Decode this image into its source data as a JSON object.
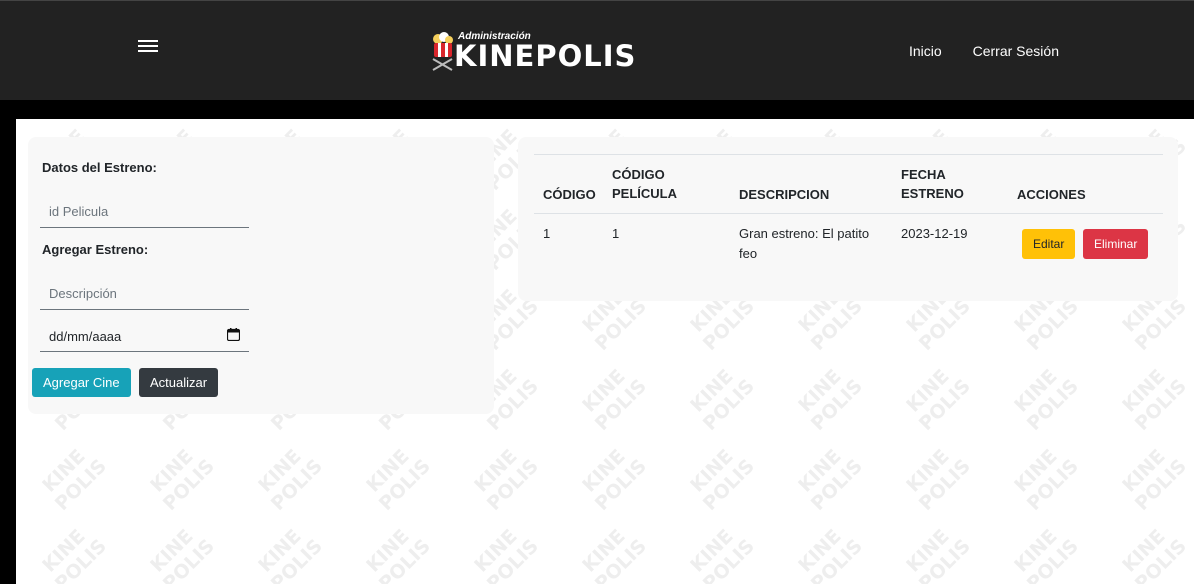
{
  "navbar": {
    "logo_sub": "Administración",
    "logo_main": "KINEPOLIS",
    "links": [
      {
        "label": "Inicio"
      },
      {
        "label": "Cerrar Sesión"
      }
    ]
  },
  "form": {
    "section1_label": "Datos del Estreno:",
    "id_pelicula_placeholder": "id Pelicula",
    "section2_label": "Agregar Estreno:",
    "descripcion_placeholder": "Descripción",
    "date_placeholder": "dd/mm/aaaa",
    "add_button": "Agregar Cine",
    "update_button": "Actualizar"
  },
  "table": {
    "headers": {
      "codigo": "CÓDIGO",
      "codigo_pelicula_line1": "CÓDIGO",
      "codigo_pelicula_line2": "PELÍCULA",
      "descripcion": "DESCRIPCION",
      "fecha_line1": "FECHA",
      "fecha_line2": "ESTRENO",
      "acciones": "ACCIONES"
    },
    "rows": [
      {
        "codigo": "1",
        "codigo_pelicula": "1",
        "descripcion_line1": "Gran estreno: El patito",
        "descripcion_line2": "feo",
        "fecha": "2023-12-19",
        "edit_label": "Editar",
        "delete_label": "Eliminar"
      }
    ]
  },
  "watermark_text": [
    "KINE",
    "POLIS"
  ],
  "colors": {
    "navbar": "#222222",
    "info": "#17a2b8",
    "dark": "#343a40",
    "warning": "#ffc107",
    "danger": "#dc3545"
  }
}
